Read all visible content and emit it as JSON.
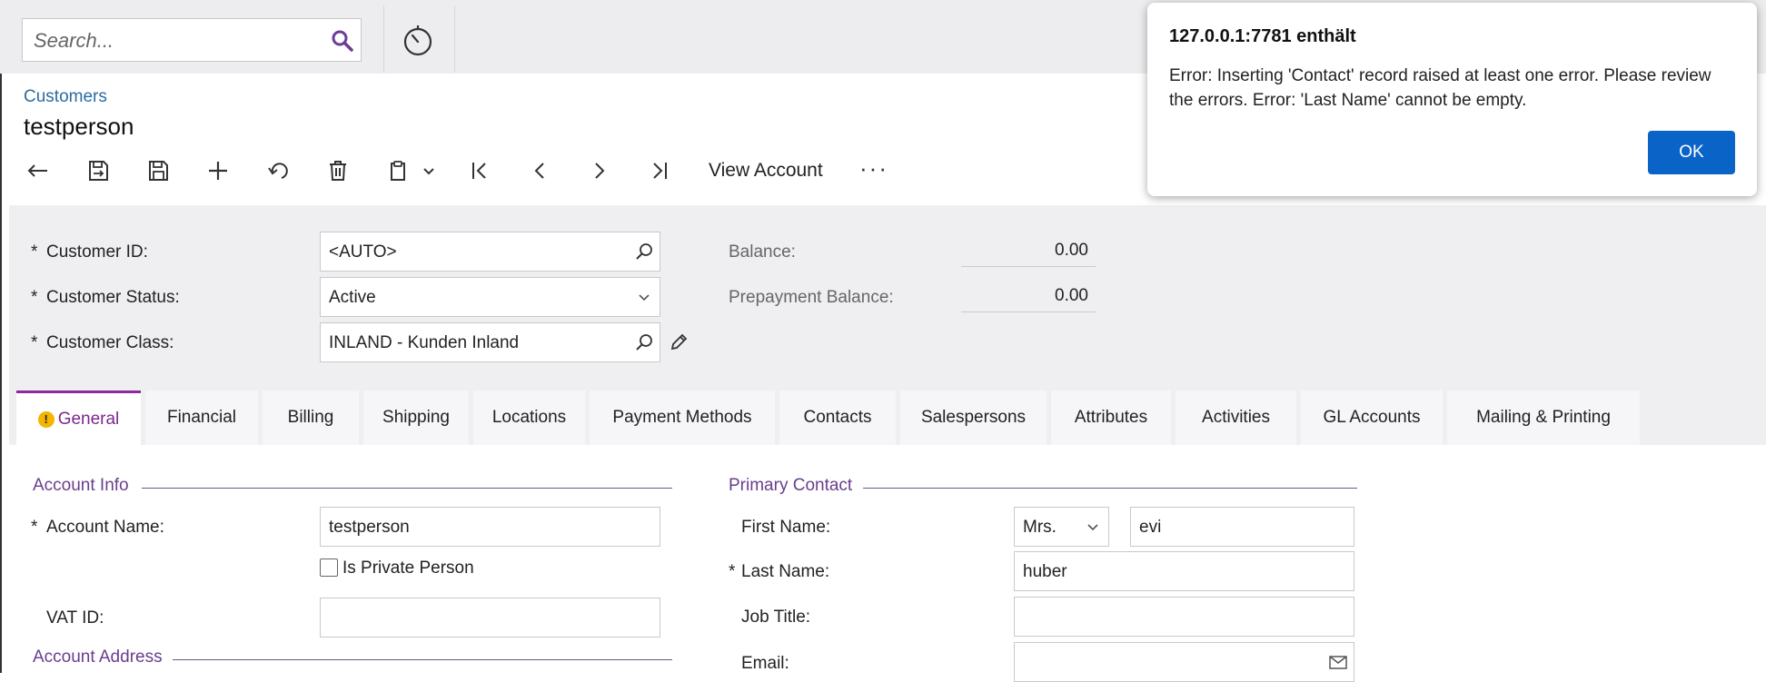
{
  "search": {
    "placeholder": "Search..."
  },
  "header": {
    "breadcrumb": "Customers",
    "title": "testperson"
  },
  "toolbar": {
    "view_account": "View Account",
    "more": "···"
  },
  "summary": {
    "customer_id_label": "Customer ID:",
    "customer_id_value": "<AUTO>",
    "customer_status_label": "Customer Status:",
    "customer_status_value": "Active",
    "customer_class_label": "Customer Class:",
    "customer_class_value": "INLAND - Kunden Inland",
    "balance_label": "Balance:",
    "balance_value": "0.00",
    "prepayment_label": "Prepayment Balance:",
    "prepayment_value": "0.00",
    "required_mark": "*"
  },
  "tabs": [
    {
      "label": "General",
      "active": true
    },
    {
      "label": "Financial"
    },
    {
      "label": "Billing"
    },
    {
      "label": "Shipping"
    },
    {
      "label": "Locations"
    },
    {
      "label": "Payment Methods"
    },
    {
      "label": "Contacts"
    },
    {
      "label": "Salespersons"
    },
    {
      "label": "Attributes"
    },
    {
      "label": "Activities"
    },
    {
      "label": "GL Accounts"
    },
    {
      "label": "Mailing & Printing"
    }
  ],
  "general": {
    "account_info_title": "Account Info",
    "account_name_label": "Account Name:",
    "account_name_value": "testperson",
    "is_private_label": "Is Private Person",
    "vat_label": "VAT ID:",
    "vat_value": "",
    "account_address_title": "Account Address",
    "primary_contact_title": "Primary Contact",
    "first_name_label": "First Name:",
    "salutation_value": "Mrs.",
    "first_name_value": "evi",
    "last_name_label": "Last Name:",
    "last_name_value": "huber",
    "job_title_label": "Job Title:",
    "job_title_value": "",
    "email_label": "Email:",
    "email_value": ""
  },
  "dialog": {
    "title": "127.0.0.1:7781 enthält",
    "message": "Error: Inserting  'Contact' record raised at least one error. Please review the errors. Error: 'Last Name' cannot be empty.",
    "ok_label": "OK"
  },
  "colors": {
    "accent": "#8b2a9a",
    "link": "#2b6ca3",
    "ok_button": "#0a64c8"
  }
}
